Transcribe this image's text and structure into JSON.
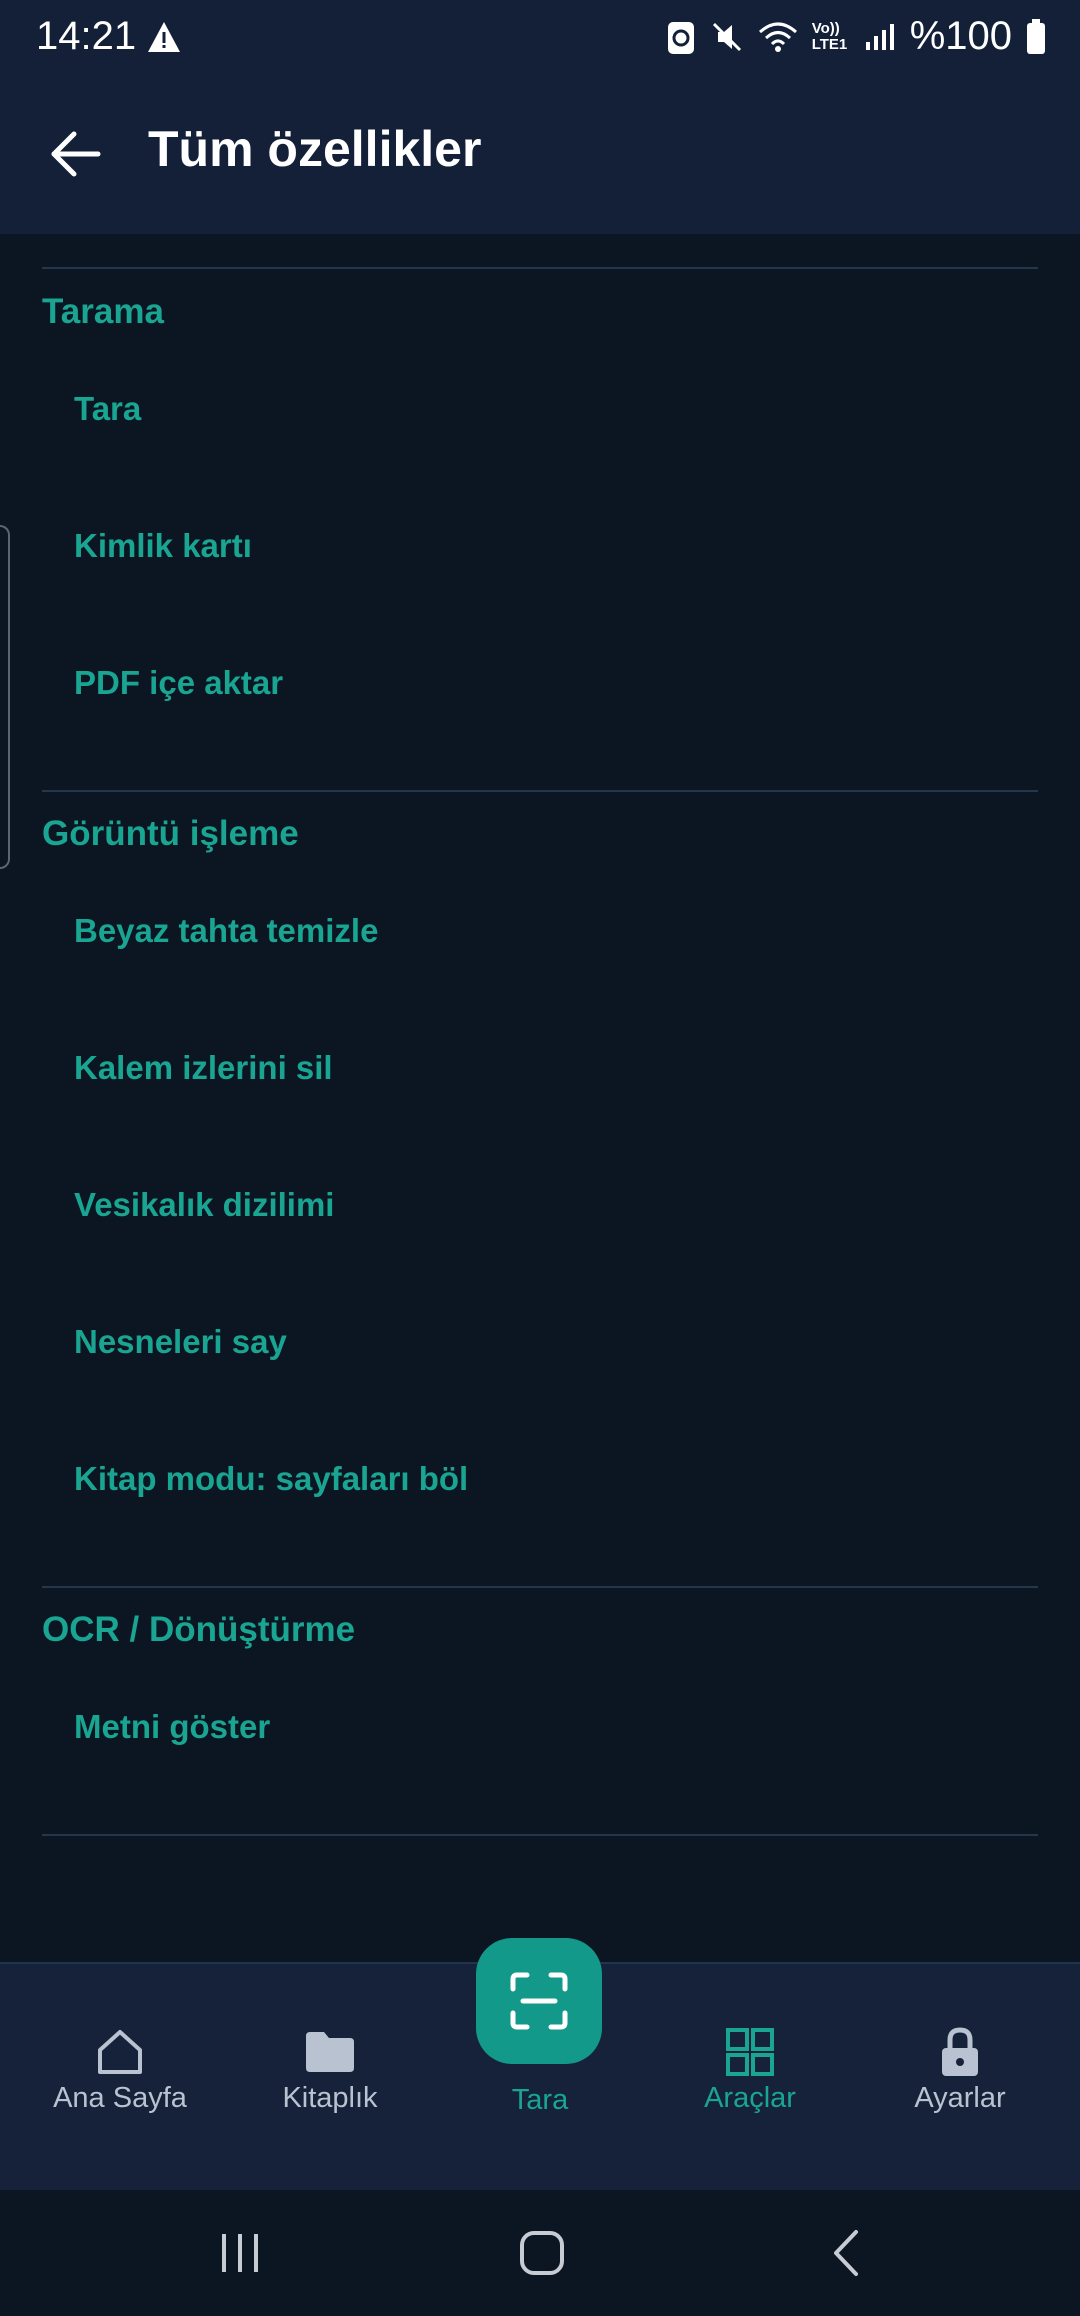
{
  "status_bar": {
    "time": "14:21",
    "battery_text": "%100",
    "lte_label": "Vo)) LTE1",
    "icons": [
      "warning-icon",
      "recycle-icon",
      "mute-icon",
      "wifi-icon",
      "signal-icon",
      "battery-icon"
    ]
  },
  "app_bar": {
    "title": "Tüm özellikler",
    "back_icon": "arrow-left-icon"
  },
  "sections": [
    {
      "title": "Tarama",
      "items": [
        "Tara",
        "Kimlik kartı",
        "PDF içe aktar"
      ]
    },
    {
      "title": "Görüntü işleme",
      "items": [
        "Beyaz tahta temizle",
        "Kalem izlerini sil",
        "Vesikalık dizilimi",
        "Nesneleri say",
        "Kitap modu: sayfaları böl"
      ]
    },
    {
      "title": "OCR / Dönüştürme",
      "items": [
        "Metni göster"
      ]
    }
  ],
  "bottom_nav": {
    "items": [
      {
        "label": "Ana Sayfa",
        "icon": "home-icon"
      },
      {
        "label": "Kitaplık",
        "icon": "folder-icon"
      },
      {
        "label": "Tara",
        "icon": "scan-icon"
      },
      {
        "label": "Araçlar",
        "icon": "grid-icon"
      },
      {
        "label": "Ayarlar",
        "icon": "lock-icon"
      }
    ],
    "active": "Araçlar"
  },
  "system_nav": {
    "icons": [
      "recent-apps-icon",
      "home-button-icon",
      "back-button-icon"
    ]
  },
  "colors": {
    "background": "#0c1522",
    "bar": "#132038",
    "accent": "#19a592",
    "fab": "#12998a",
    "nav_label": "#b8c2d0"
  }
}
